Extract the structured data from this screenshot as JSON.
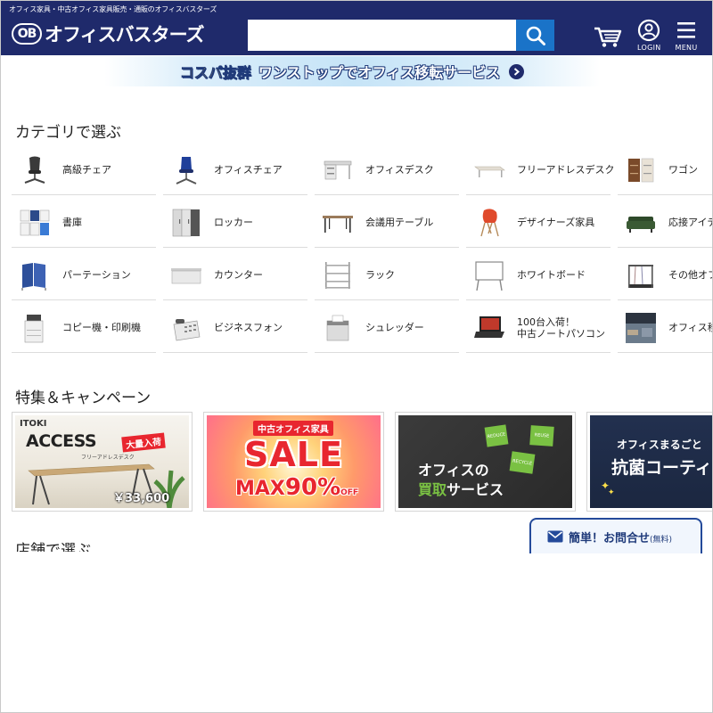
{
  "header": {
    "tagline": "オフィス家具・中古オフィス家具販売・通販のオフィスバスターズ",
    "logo_mark": "OB",
    "logo_text": "オフィスバスターズ",
    "search": {
      "value": "",
      "placeholder": ""
    },
    "login_label": "LOGIN",
    "menu_label": "MENU"
  },
  "banner": {
    "part1": "コスパ抜群",
    "part2": "ワンストップでオフィス移転サービス"
  },
  "categories": {
    "title": "カテゴリで選ぶ",
    "items": [
      {
        "label": "高級チェア"
      },
      {
        "label": "オフィスチェア"
      },
      {
        "label": "オフィスデスク"
      },
      {
        "label": "フリーアドレスデスク"
      },
      {
        "label": "ワゴン"
      },
      {
        "label": "書庫"
      },
      {
        "label": "ロッカー"
      },
      {
        "label": "会議用テーブル"
      },
      {
        "label": "デザイナーズ家具"
      },
      {
        "label": "応接アイテ"
      },
      {
        "label": "パーテーション"
      },
      {
        "label": "カウンター"
      },
      {
        "label": "ラック"
      },
      {
        "label": "ホワイトボード"
      },
      {
        "label": "その他オフ"
      },
      {
        "label": "コピー機・印刷機"
      },
      {
        "label": "ビジネスフォン"
      },
      {
        "label": "シュレッダー"
      },
      {
        "label": "100台入荷！",
        "label2": "中古ノートパソコン"
      },
      {
        "label": "オフィス移"
      }
    ]
  },
  "features": {
    "title": "特集＆キャンペーン",
    "cards": [
      {
        "brand": "ITOKI",
        "name": "ACCESS",
        "badge": "大量入荷",
        "sub": "フリーアドレスデスク",
        "price": "￥33,600"
      },
      {
        "top": "中古オフィス家具",
        "sale": "SALE",
        "max": "MAX",
        "pct": "90%",
        "off": "OFF"
      },
      {
        "line1": "オフィスの",
        "line2a": "買取",
        "line2b": "サービス",
        "tags": [
          "REDUCE",
          "REUSE",
          "RECYCLE"
        ]
      },
      {
        "line1": "オフィスまるごと",
        "line2": "抗菌コーティ"
      }
    ]
  },
  "stores": {
    "title": "店舗で選ぶ"
  },
  "inquiry": {
    "label": "簡単！お問合せ",
    "small": "(無料)"
  },
  "colors": {
    "header": "#1f2a6b",
    "search_button": "#1a73c8",
    "sale_red": "#e8262f",
    "accent_green": "#7ac143"
  }
}
